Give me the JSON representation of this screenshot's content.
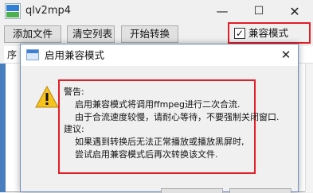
{
  "window": {
    "title": "qlv2mp4",
    "minimize_glyph": "—",
    "maximize_glyph": "☐",
    "close_glyph": "✕"
  },
  "toolbar": {
    "add_file_label": "添加文件",
    "clear_list_label": "清空列表",
    "start_convert_label": "开始转换",
    "compat_mode_label": "兼容模式",
    "compat_mode_checked": true,
    "check_glyph": "✓"
  },
  "list": {
    "header_fragment": "序"
  },
  "dialog": {
    "title": "启用兼容模式",
    "close_glyph": "✕",
    "icon": "warning-icon",
    "lines": [
      "警告:",
      "启用兼容模式将调用ffmpeg进行二次合流.",
      "由于合流速度较慢，请耐心等待，不要强制关闭窗口.",
      "建议:",
      "如果遇到转换后无法正常播放或播放黑屏时,",
      "尝试启用兼容模式后再次转换该文件."
    ]
  },
  "colors": {
    "highlight_red": "#e21e26",
    "warning_yellow": "#f6c21c"
  }
}
